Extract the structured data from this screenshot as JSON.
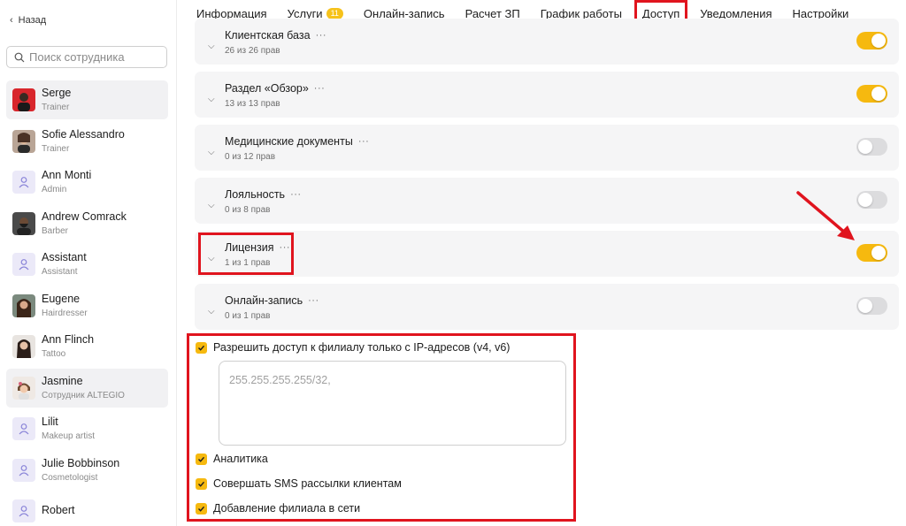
{
  "sidebar": {
    "back_label": "Назад",
    "search_placeholder": "Поиск сотрудника",
    "employees": [
      {
        "name": "Serge",
        "role": "Trainer",
        "active": true
      },
      {
        "name": "Sofie Alessandro",
        "role": "Trainer"
      },
      {
        "name": "Ann Monti",
        "role": "Admin"
      },
      {
        "name": "Andrew Comrack",
        "role": "Barber"
      },
      {
        "name": "Assistant",
        "role": "Assistant"
      },
      {
        "name": "Eugene",
        "role": "Hairdresser"
      },
      {
        "name": "Ann Flinch",
        "role": "Tattoo"
      },
      {
        "name": "Jasmine",
        "role": "Сотрудник ALTEGIO",
        "active": true
      },
      {
        "name": "Lilit",
        "role": "Makeup artist"
      },
      {
        "name": "Julie Bobbinson",
        "role": "Cosmetologist"
      },
      {
        "name": "Robert",
        "role": ""
      }
    ]
  },
  "tabs": [
    {
      "label": "Информация"
    },
    {
      "label": "Услуги",
      "badge": "11"
    },
    {
      "label": "Онлайн-запись"
    },
    {
      "label": "Расчет ЗП"
    },
    {
      "label": "График работы"
    },
    {
      "label": "Доступ",
      "active": true
    },
    {
      "label": "Уведомления"
    },
    {
      "label": "Настройки"
    }
  ],
  "permissions": [
    {
      "title": "Клиентская база",
      "count": "26 из 26 прав",
      "enabled": true
    },
    {
      "title": "Раздел «Обзор»",
      "count": "13 из 13 прав",
      "enabled": true
    },
    {
      "title": "Медицинские документы",
      "count": "0 из 12 прав",
      "enabled": false
    },
    {
      "title": "Лояльность",
      "count": "0 из 8 прав",
      "enabled": false
    },
    {
      "title": "Лицензия",
      "count": "1 из 1 прав",
      "enabled": true
    },
    {
      "title": "Онлайн-запись",
      "count": "0 из 1 прав",
      "enabled": false
    }
  ],
  "card_menu_glyph": "···",
  "settings": {
    "ip_restrict_label": "Разрешить доступ к филиалу только с IP-адресов (v4, v6)",
    "ip_placeholder": "255.255.255.255/32,",
    "analytics_label": "Аналитика",
    "sms_label": "Совершать SMS рассылки клиентам",
    "add_branch_label": "Добавление филиала в сети"
  },
  "colors": {
    "accent": "#f6b90f",
    "highlight": "#e0141e",
    "card_bg": "#f5f5f6"
  }
}
